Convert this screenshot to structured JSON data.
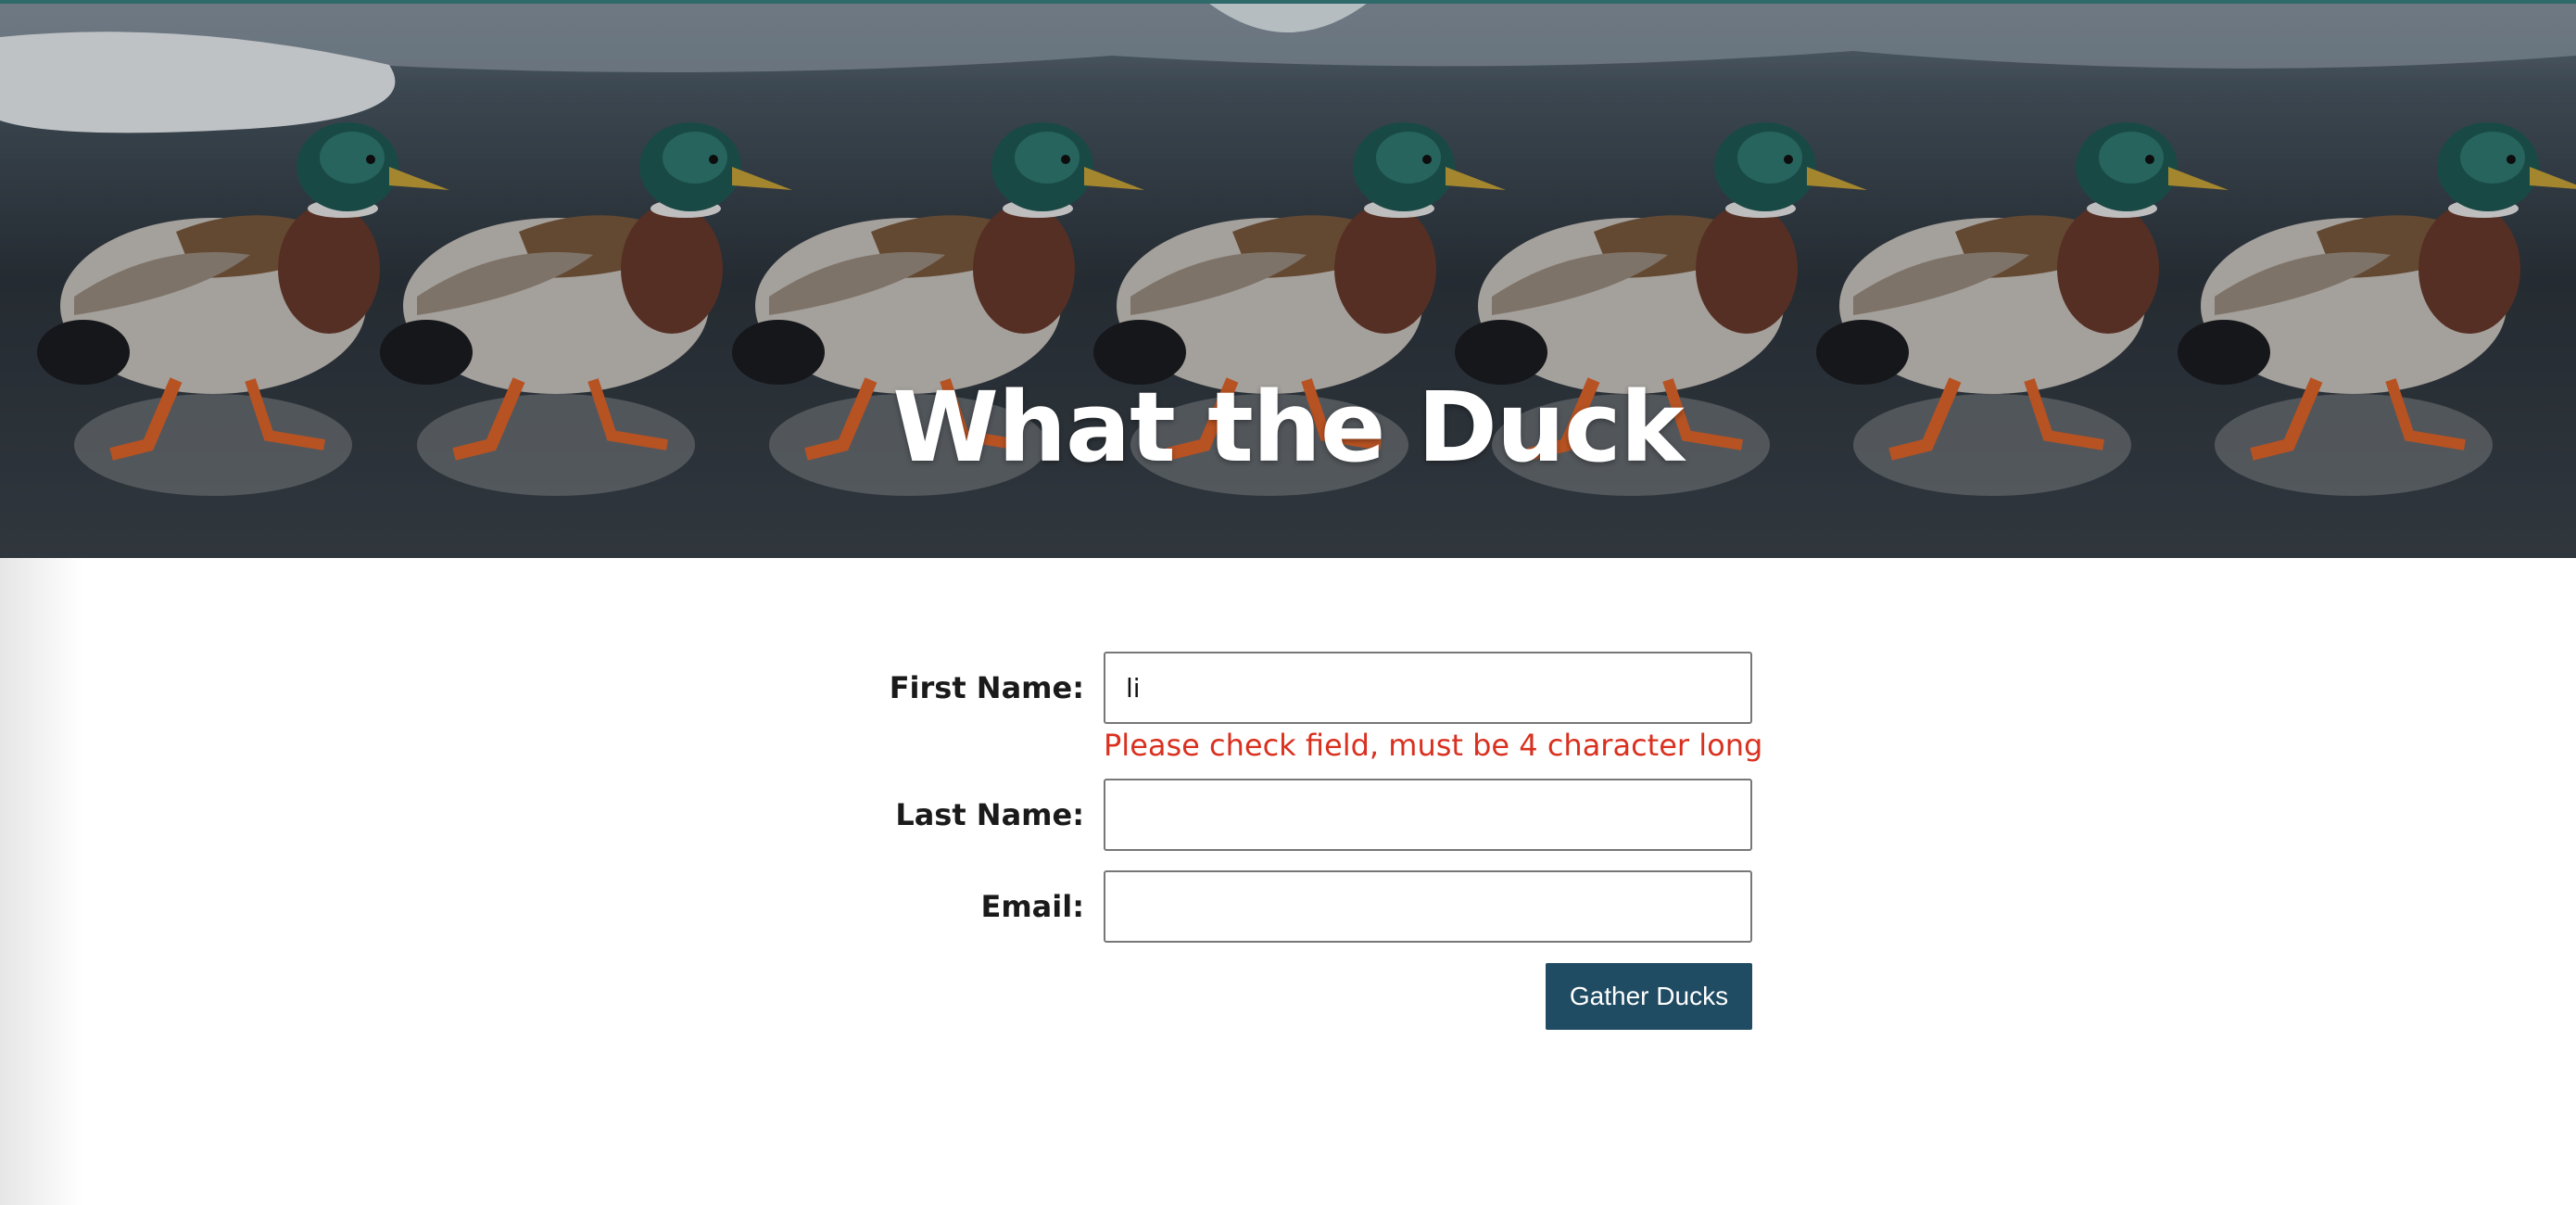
{
  "hero": {
    "title": "What the Duck",
    "image_description": "row of mallard ducks walking on icy water"
  },
  "form": {
    "first_name": {
      "label": "First Name:",
      "value": "li",
      "error": "Please check field, must be 4 character long"
    },
    "last_name": {
      "label": "Last Name:",
      "value": ""
    },
    "email": {
      "label": "Email:",
      "value": ""
    },
    "submit_label": "Gather Ducks"
  },
  "colors": {
    "accent": "#1f4b63",
    "error": "#d9301f"
  }
}
